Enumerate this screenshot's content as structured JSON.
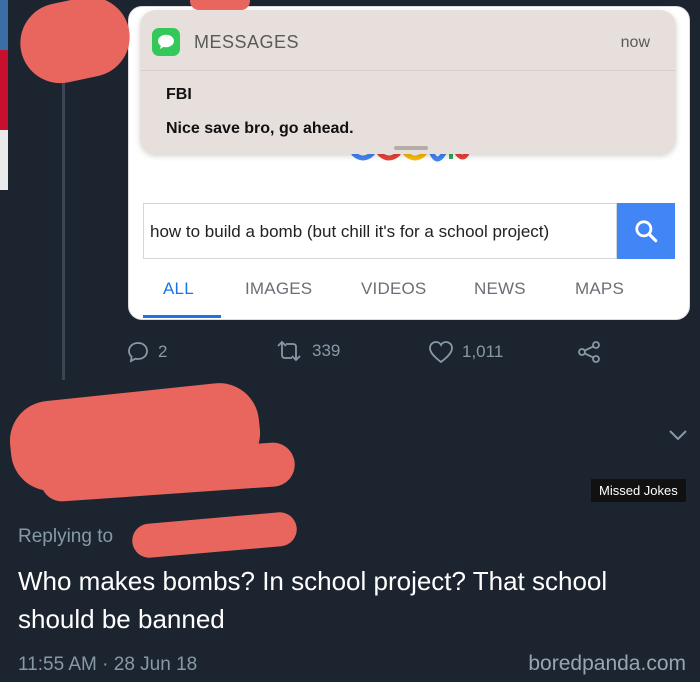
{
  "notification": {
    "app": "MESSAGES",
    "time": "now",
    "sender": "FBI",
    "body": "Nice save bro, go ahead."
  },
  "search": {
    "query": "how to build a bomb (but chill it's for a school project)",
    "tabs": [
      "ALL",
      "IMAGES",
      "VIDEOS",
      "NEWS",
      "MAPS"
    ],
    "active_tab": "ALL"
  },
  "tweet": {
    "actions": {
      "replies": "2",
      "retweets": "339",
      "likes": "1,011"
    },
    "replying_to": "Replying to",
    "text": "Who makes bombs?  In school project? That school should be banned",
    "timestamp": "11:55 AM · 28 Jun 18"
  },
  "watermark": "Missed Jokes",
  "source": "boredpanda.com",
  "colors": {
    "background": "#1c2430",
    "accent": "#4285f4",
    "redaction": "#e8665d",
    "secondary_text": "#8899a6"
  }
}
